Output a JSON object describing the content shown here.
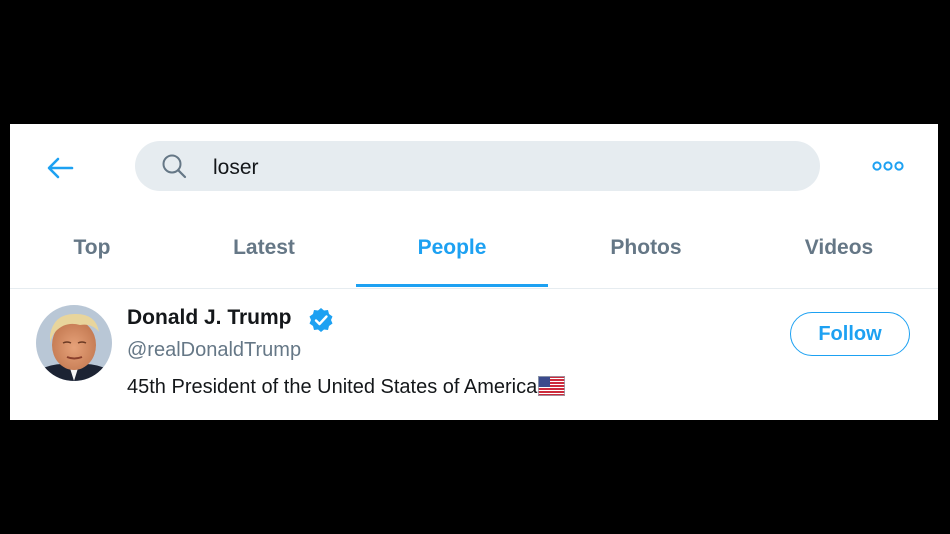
{
  "colors": {
    "accent": "#1da1f2",
    "tab_inactive": "#657786",
    "text_primary": "#14171a",
    "search_bg": "#e6ecf0",
    "backdrop": "#000000"
  },
  "header": {
    "back_icon": "arrow-left-icon",
    "more_icon": "more-dots-icon",
    "search": {
      "icon": "search-icon",
      "value": "loser"
    }
  },
  "tabs": [
    {
      "label": "Top",
      "active": false
    },
    {
      "label": "Latest",
      "active": false
    },
    {
      "label": "People",
      "active": true
    },
    {
      "label": "Photos",
      "active": false
    },
    {
      "label": "Videos",
      "active": false
    }
  ],
  "results": [
    {
      "name": "Donald J. Trump",
      "verified": true,
      "handle": "@realDonaldTrump",
      "bio": "45th President of the United States of America",
      "bio_emoji": "us-flag-emoji",
      "follow_label": "Follow"
    }
  ]
}
